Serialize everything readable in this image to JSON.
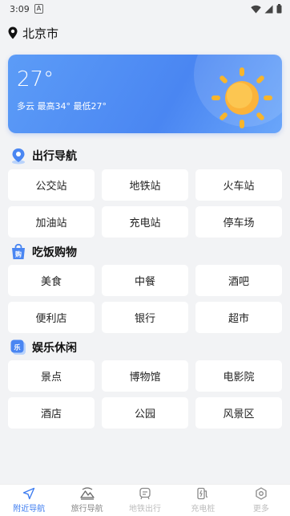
{
  "status_bar": {
    "time": "3:09",
    "indicator": "A"
  },
  "location": {
    "city": "北京市"
  },
  "weather": {
    "temperature": "27°",
    "description": "多云 最高34° 最低27°"
  },
  "sections": [
    {
      "title": "出行导航",
      "icon": "map-pin-badge-icon",
      "items": [
        "公交站",
        "地铁站",
        "火车站",
        "加油站",
        "充电站",
        "停车场"
      ]
    },
    {
      "title": "吃饭购物",
      "icon": "shopping-bag-icon",
      "items": [
        "美食",
        "中餐",
        "酒吧",
        "便利店",
        "银行",
        "超市"
      ]
    },
    {
      "title": "娱乐休闲",
      "icon": "leisure-badge-icon",
      "items": [
        "景点",
        "博物馆",
        "电影院",
        "酒店",
        "公园",
        "风景区"
      ]
    }
  ],
  "tabbar": [
    {
      "label": "附近导航",
      "icon": "navigation-arrow-icon",
      "active": true
    },
    {
      "label": "旅行导航",
      "icon": "mountain-icon",
      "active": false
    },
    {
      "label": "地铁出行",
      "icon": "subway-icon",
      "active": false
    },
    {
      "label": "充电桩",
      "icon": "charging-pile-icon",
      "active": false
    },
    {
      "label": "更多",
      "icon": "settings-hex-icon",
      "active": false
    }
  ],
  "colors": {
    "accent": "#3d7cf0",
    "card_gradient_start": "#5c9cf7",
    "card_gradient_end": "#4a86f2",
    "sun": "#f7b52c"
  }
}
